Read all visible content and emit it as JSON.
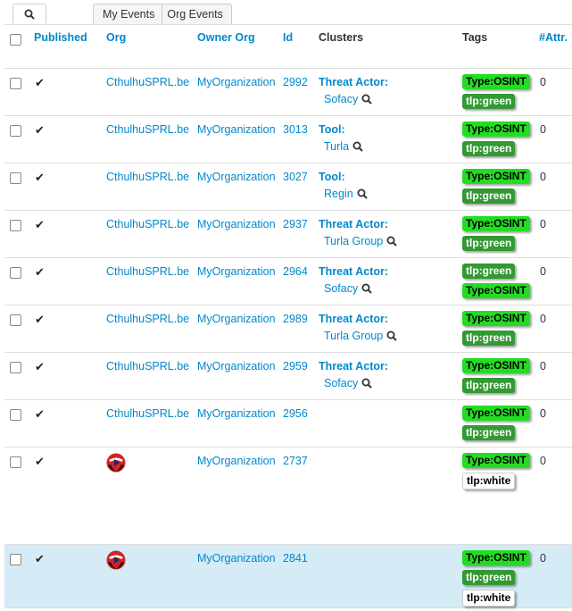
{
  "toolbar": {
    "tabs": [
      "My Events",
      "Org Events"
    ]
  },
  "columns": {
    "published": "Published",
    "org": "Org",
    "owner_org": "Owner Org",
    "id": "Id",
    "clusters": "Clusters",
    "tags": "Tags",
    "attr": "#Attr."
  },
  "rows": [
    {
      "published": "✔",
      "org": "CthulhuSPRL.be",
      "owner_org": "MyOrganization",
      "id": "2992",
      "cluster_type": "Threat Actor:",
      "cluster_value": "Sofacy",
      "tags": [
        "Type:OSINT",
        "tlp:green"
      ],
      "attr": "0"
    },
    {
      "published": "✔",
      "org": "CthulhuSPRL.be",
      "owner_org": "MyOrganization",
      "id": "3013",
      "cluster_type": "Tool:",
      "cluster_value": "Turla",
      "tags": [
        "Type:OSINT",
        "tlp:green"
      ],
      "attr": "0"
    },
    {
      "published": "✔",
      "org": "CthulhuSPRL.be",
      "owner_org": "MyOrganization",
      "id": "3027",
      "cluster_type": "Tool:",
      "cluster_value": "Regin",
      "tags": [
        "Type:OSINT",
        "tlp:green"
      ],
      "attr": "0"
    },
    {
      "published": "✔",
      "org": "CthulhuSPRL.be",
      "owner_org": "MyOrganization",
      "id": "2937",
      "cluster_type": "Threat Actor:",
      "cluster_value": "Turla Group",
      "tags": [
        "Type:OSINT",
        "tlp:green"
      ],
      "attr": "0"
    },
    {
      "published": "✔",
      "org": "CthulhuSPRL.be",
      "owner_org": "MyOrganization",
      "id": "2964",
      "cluster_type": "Threat Actor:",
      "cluster_value": "Sofacy",
      "tags": [
        "tlp:green",
        "Type:OSINT"
      ],
      "attr": "0"
    },
    {
      "published": "✔",
      "org": "CthulhuSPRL.be",
      "owner_org": "MyOrganization",
      "id": "2989",
      "cluster_type": "Threat Actor:",
      "cluster_value": "Turla Group",
      "tags": [
        "Type:OSINT",
        "tlp:green"
      ],
      "attr": "0"
    },
    {
      "published": "✔",
      "org": "CthulhuSPRL.be",
      "owner_org": "MyOrganization",
      "id": "2959",
      "cluster_type": "Threat Actor:",
      "cluster_value": "Sofacy",
      "tags": [
        "Type:OSINT",
        "tlp:green"
      ],
      "attr": "0"
    },
    {
      "published": "✔",
      "org": "CthulhuSPRL.be",
      "owner_org": "MyOrganization",
      "id": "2956",
      "cluster_type": "",
      "cluster_value": "",
      "tags": [
        "Type:OSINT",
        "tlp:green"
      ],
      "attr": "0"
    },
    {
      "published": "✔",
      "org": "",
      "owner_org": "MyOrganization",
      "id": "2737",
      "cluster_type": "",
      "cluster_value": "",
      "tags": [
        "Type:OSINT",
        "tlp:white"
      ],
      "attr": "0"
    },
    {
      "published": "✔",
      "org": "",
      "owner_org": "MyOrganization",
      "id": "2841",
      "cluster_type": "",
      "cluster_value": "",
      "tags": [
        "Type:OSINT",
        "tlp:green",
        "tlp:white"
      ],
      "attr": "0"
    }
  ],
  "colors": {
    "link": "#0088cc",
    "osint": "#22dd22",
    "green": "#339933",
    "selected_row": "#d5ebf6"
  }
}
